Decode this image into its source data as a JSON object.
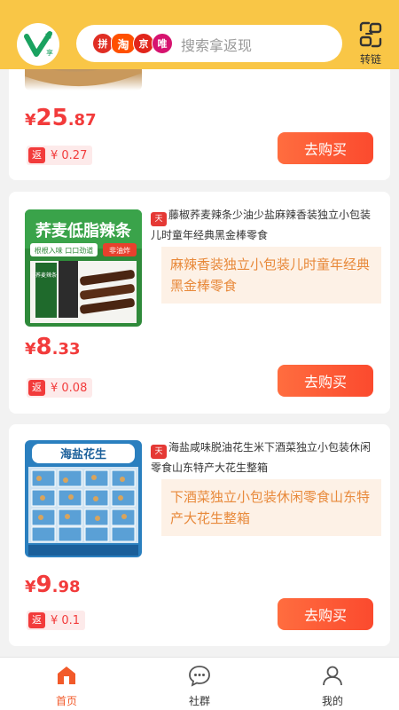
{
  "header": {
    "platform_badges": [
      "拼",
      "淘",
      "京",
      "唯"
    ],
    "search_placeholder": "搜索拿返现",
    "transfer_label": "转链",
    "logo_mark": "享"
  },
  "products": [
    {
      "title": "",
      "description": "",
      "price_symbol": "¥",
      "price_int": "25",
      "price_dec": ".87",
      "rebate_tag": "返",
      "rebate_value": "¥ 0.27",
      "buy_label": "去购买"
    },
    {
      "title": "藤椒荞麦辣条少油少盐麻辣香装独立小包装儿时童年经典黑金棒零食",
      "description": "麻辣香装独立小包装儿时童年经典黑金棒零食",
      "price_symbol": "¥",
      "price_int": "8",
      "price_dec": ".33",
      "rebate_tag": "返",
      "rebate_value": "¥ 0.08",
      "buy_label": "去购买",
      "thumb_text": {
        "headline": "荞麦低脂辣条",
        "tag_left": "根根入味 口口劲道",
        "tag_right": "非油炸",
        "pack": "荞麦辣条"
      }
    },
    {
      "title": "海盐咸味脱油花生米下酒菜独立小包装休闲零食山东特产大花生整箱",
      "description": "下酒菜独立小包装休闲零食山东特产大花生整箱",
      "price_symbol": "¥",
      "price_int": "9",
      "price_dec": ".98",
      "rebate_tag": "返",
      "rebate_value": "¥ 0.1",
      "buy_label": "去购买",
      "thumb_text": {
        "headline": "海盐花生"
      }
    }
  ],
  "nav": [
    {
      "label": "首页",
      "active": true
    },
    {
      "label": "社群",
      "active": false
    },
    {
      "label": "我的",
      "active": false
    }
  ],
  "colors": {
    "header_bg": "#f9c646",
    "price_red": "#f23b3b",
    "buy_gradient_start": "#ff6d3f",
    "buy_gradient_end": "#fb4a2e",
    "desc_bg": "#fdf1e6",
    "desc_text": "#e8893a",
    "nav_active": "#f25a2a"
  }
}
